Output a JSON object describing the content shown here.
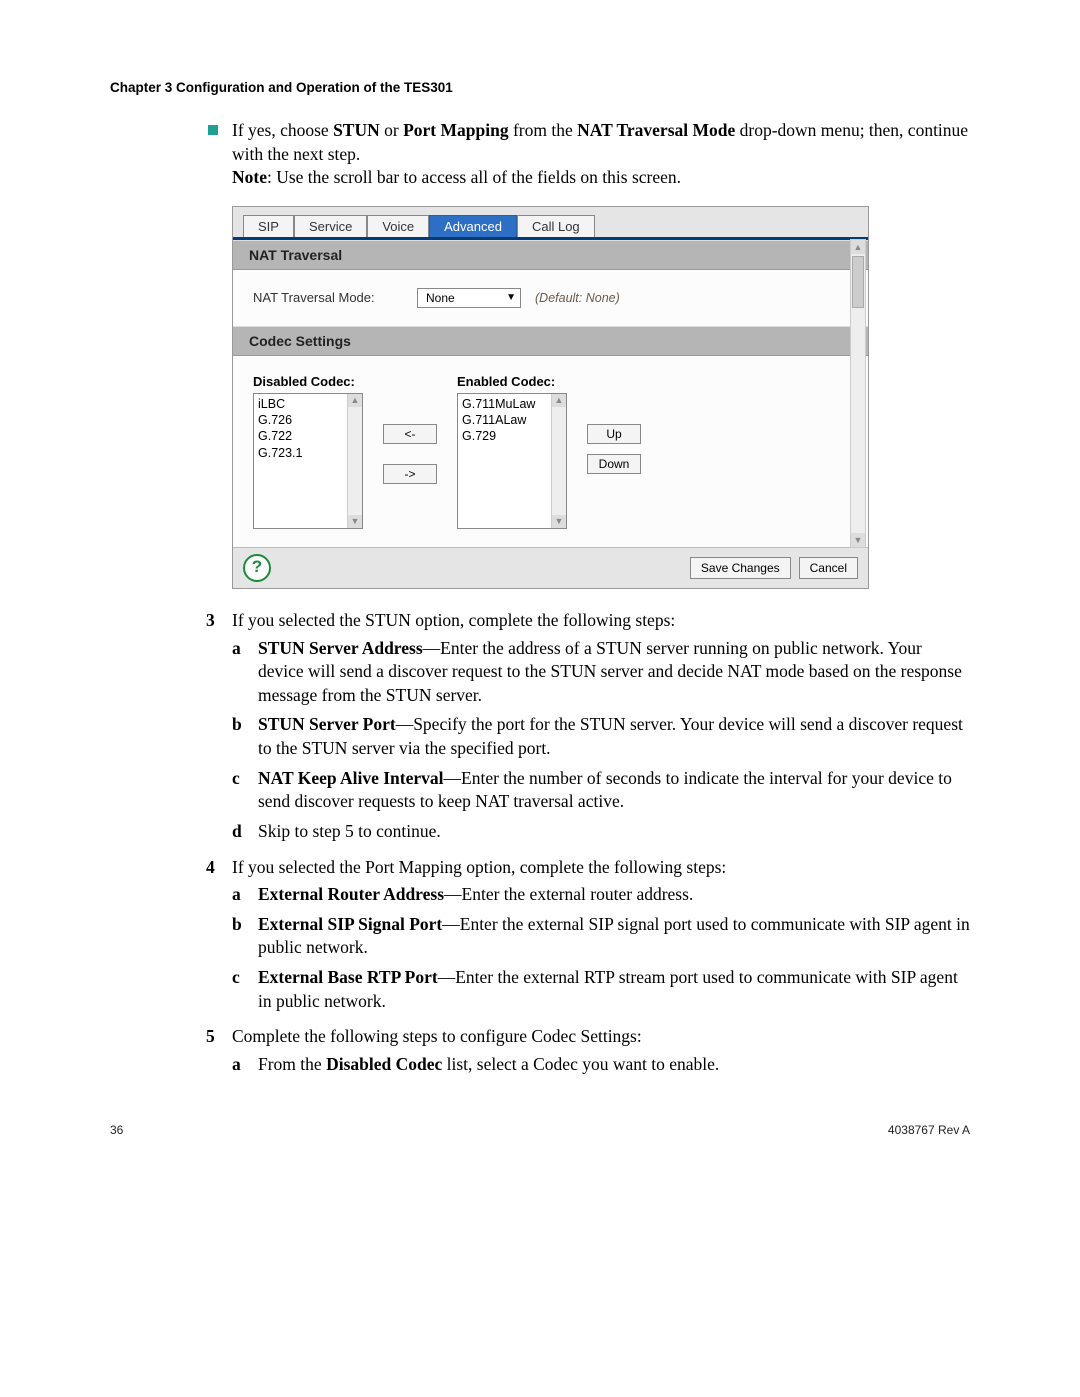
{
  "header": {
    "chapter": "Chapter 3    Configuration and Operation of the TES301"
  },
  "intro": {
    "line1_pre": "If yes, choose ",
    "bold1": "STUN",
    "mid1": " or ",
    "bold2": "Port Mapping",
    "mid2": " from the ",
    "bold3": "NAT Traversal Mode",
    "line1_post": " drop-down menu; then, continue with the next step.",
    "note_b": "Note",
    "note_rest": ": Use the scroll bar to access all of the fields on this screen."
  },
  "ui": {
    "tabs": [
      "SIP",
      "Service",
      "Voice",
      "Advanced",
      "Call Log"
    ],
    "active_tab": "Advanced",
    "section1": "NAT Traversal",
    "nat_label": "NAT Traversal Mode:",
    "nat_value": "None",
    "nat_default": "(Default: None)",
    "section2": "Codec Settings",
    "disabled_title": "Disabled Codec:",
    "disabled_items": [
      "iLBC",
      "G.726",
      "G.722",
      "G.723.1"
    ],
    "enabled_title": "Enabled Codec:",
    "enabled_items": [
      "G.711MuLaw",
      "G.711ALaw",
      "G.729"
    ],
    "btn_left": "<-",
    "btn_right": "->",
    "btn_up": "Up",
    "btn_down": "Down",
    "btn_save": "Save Changes",
    "btn_cancel": "Cancel",
    "help": "?"
  },
  "steps": {
    "s3": {
      "num": "3",
      "text": "If you selected the STUN option, complete the following steps:",
      "a_b": "STUN Server Address",
      "a_t": "—Enter the address of a STUN server running on public network. Your device will send a discover request to the STUN server and decide NAT mode based on the response message from the STUN server.",
      "b_b": "STUN Server Port",
      "b_t": "—Specify the port for the STUN server. Your device will send a discover request to the STUN server via the specified port.",
      "c_b": "NAT Keep Alive Interval",
      "c_t": "—Enter the number of seconds to indicate the interval for your device to send discover requests to keep NAT traversal active.",
      "d_t": "Skip to step 5 to continue."
    },
    "s4": {
      "num": "4",
      "text": "If you selected the Port Mapping option, complete the following steps:",
      "a_b": "External Router Address",
      "a_t": "—Enter the external router address.",
      "b_b": "External SIP Signal Port",
      "b_t": "—Enter the external SIP signal port used to communicate with SIP agent in public network.",
      "c_b": "External Base RTP Port",
      "c_t": "—Enter the external RTP stream port used to communicate with SIP agent in public network."
    },
    "s5": {
      "num": "5",
      "text": "Complete the following steps to configure Codec Settings:",
      "a_pre": "From the ",
      "a_b": "Disabled Codec",
      "a_post": " list, select a Codec you want to enable."
    }
  },
  "footer": {
    "page": "36",
    "rev": "4038767 Rev A"
  }
}
